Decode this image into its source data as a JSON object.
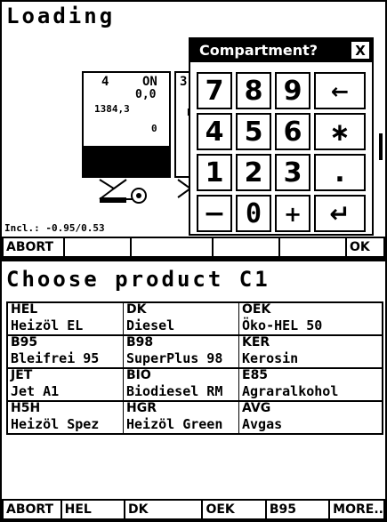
{
  "loading_screen": {
    "title": "Loading",
    "compartment_4": {
      "number": "4",
      "state": "ON",
      "value1": "0,0",
      "value2": "1384,3",
      "value3": "0"
    },
    "compartment_3": {
      "number": "3",
      "partial_label": "E"
    },
    "incline_label": "Incl.: -0.95/0.53",
    "softkeys": [
      "ABORT",
      "",
      "",
      "",
      "",
      "",
      "OK"
    ]
  },
  "keypad_dialog": {
    "title": "Compartment?",
    "close_label": "X",
    "keys": [
      [
        "7",
        "8",
        "9",
        "←"
      ],
      [
        "4",
        "5",
        "6",
        "∗"
      ],
      [
        "1",
        "2",
        "3",
        "."
      ],
      [
        "−",
        "0",
        "+",
        "↵"
      ]
    ]
  },
  "product_screen": {
    "title": "Choose product C1",
    "products": [
      {
        "code": "HEL",
        "name": "Heizöl EL"
      },
      {
        "code": "DK",
        "name": "Diesel"
      },
      {
        "code": "OEK",
        "name": "Öko-HEL 50"
      },
      {
        "code": "B95",
        "name": "Bleifrei 95"
      },
      {
        "code": "B98",
        "name": "SuperPlus 98"
      },
      {
        "code": "KER",
        "name": "Kerosin"
      },
      {
        "code": "JET",
        "name": "Jet A1"
      },
      {
        "code": "BIO",
        "name": "Biodiesel RM"
      },
      {
        "code": "E85",
        "name": "Agraralkohol"
      },
      {
        "code": "H5H",
        "name": "Heizöl Spez"
      },
      {
        "code": "HGR",
        "name": "Heizöl Green"
      },
      {
        "code": "AVG",
        "name": "Avgas"
      }
    ],
    "softkeys": [
      "ABORT",
      "HEL",
      "DK",
      "OEK",
      "B95",
      "MORE.."
    ]
  }
}
